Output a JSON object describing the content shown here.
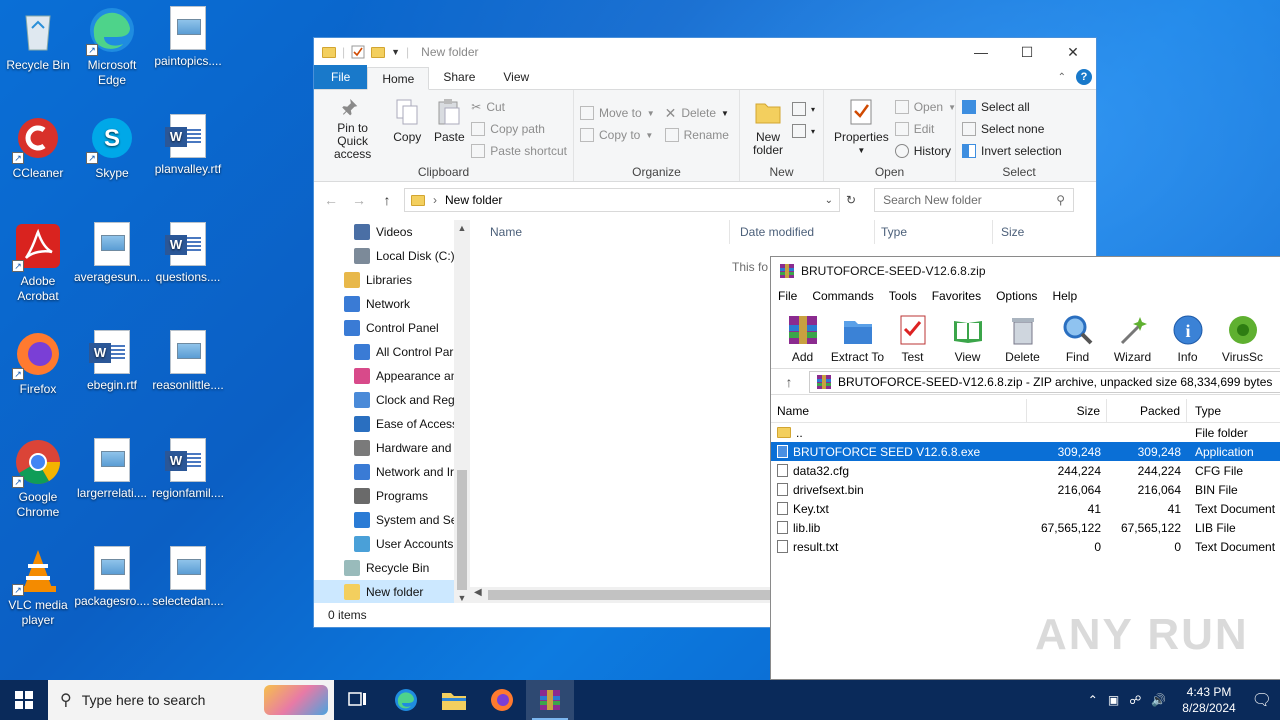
{
  "desktop": {
    "icons": [
      {
        "label": "Recycle Bin",
        "icon": "recycle-bin-icon"
      },
      {
        "label": "Microsoft Edge",
        "icon": "edge-icon"
      },
      {
        "label": "paintopics....",
        "icon": "image-file-icon"
      },
      {
        "label": "CCleaner",
        "icon": "ccleaner-icon"
      },
      {
        "label": "Skype",
        "icon": "skype-icon"
      },
      {
        "label": "planvalley.rtf",
        "icon": "word-doc-icon"
      },
      {
        "label": "Adobe Acrobat",
        "icon": "acrobat-icon"
      },
      {
        "label": "averagesun....",
        "icon": "image-file-icon"
      },
      {
        "label": "questions....",
        "icon": "word-doc-icon"
      },
      {
        "label": "Firefox",
        "icon": "firefox-icon"
      },
      {
        "label": "ebegin.rtf",
        "icon": "word-doc-icon"
      },
      {
        "label": "reasonlittle....",
        "icon": "image-file-icon"
      },
      {
        "label": "Google Chrome",
        "icon": "chrome-icon"
      },
      {
        "label": "largerrelati....",
        "icon": "image-file-icon"
      },
      {
        "label": "regionfamil....",
        "icon": "word-doc-icon"
      },
      {
        "label": "VLC media player",
        "icon": "vlc-icon"
      },
      {
        "label": "packagesro....",
        "icon": "image-file-icon"
      },
      {
        "label": "selectedan....",
        "icon": "image-file-icon"
      }
    ]
  },
  "explorer": {
    "title": "New folder",
    "tabs": {
      "file": "File",
      "home": "Home",
      "share": "Share",
      "view": "View"
    },
    "clipboard": {
      "pin": "Pin to Quick access",
      "copy": "Copy",
      "paste": "Paste",
      "cut": "Cut",
      "copy_path": "Copy path",
      "paste_shortcut": "Paste shortcut",
      "label": "Clipboard"
    },
    "organize": {
      "move_to": "Move to",
      "copy_to": "Copy to",
      "delete": "Delete",
      "rename": "Rename",
      "label": "Organize"
    },
    "new": {
      "new_folder": "New folder",
      "label": "New"
    },
    "open": {
      "properties": "Properties",
      "open": "Open",
      "edit": "Edit",
      "history": "History",
      "label": "Open"
    },
    "select": {
      "select_all": "Select all",
      "select_none": "Select none",
      "invert": "Invert selection",
      "label": "Select"
    },
    "address": "New folder",
    "search_placeholder": "Search New folder",
    "nav": [
      {
        "label": "Videos",
        "indent": 2,
        "icon": "videos-icon"
      },
      {
        "label": "Local Disk (C:)",
        "indent": 2,
        "icon": "disk-icon"
      },
      {
        "label": "Libraries",
        "indent": 1,
        "icon": "libraries-icon"
      },
      {
        "label": "Network",
        "indent": 1,
        "icon": "network-icon"
      },
      {
        "label": "Control Panel",
        "indent": 1,
        "icon": "control-panel-icon"
      },
      {
        "label": "All Control Par",
        "indent": 2,
        "icon": "control-panel-icon"
      },
      {
        "label": "Appearance an",
        "indent": 2,
        "icon": "appearance-icon"
      },
      {
        "label": "Clock and Regi",
        "indent": 2,
        "icon": "clock-icon"
      },
      {
        "label": "Ease of Access",
        "indent": 2,
        "icon": "ease-access-icon"
      },
      {
        "label": "Hardware and",
        "indent": 2,
        "icon": "hardware-icon"
      },
      {
        "label": "Network and Ir",
        "indent": 2,
        "icon": "network-icon"
      },
      {
        "label": "Programs",
        "indent": 2,
        "icon": "programs-icon"
      },
      {
        "label": "System and Sec",
        "indent": 2,
        "icon": "shield-icon"
      },
      {
        "label": "User Accounts",
        "indent": 2,
        "icon": "user-icon"
      },
      {
        "label": "Recycle Bin",
        "indent": 1,
        "icon": "recycle-bin-icon"
      },
      {
        "label": "New folder",
        "indent": 1,
        "icon": "folder-icon",
        "selected": true
      }
    ],
    "columns": {
      "name": "Name",
      "date": "Date modified",
      "type": "Type",
      "size": "Size"
    },
    "empty_message": "This fo",
    "status": "0 items"
  },
  "winrar": {
    "title": "BRUTOFORCE-SEED-V12.6.8.zip",
    "menu": [
      "File",
      "Commands",
      "Tools",
      "Favorites",
      "Options",
      "Help"
    ],
    "tools": [
      {
        "label": "Add",
        "icon": "add-archive-icon"
      },
      {
        "label": "Extract To",
        "icon": "extract-icon"
      },
      {
        "label": "Test",
        "icon": "test-icon"
      },
      {
        "label": "View",
        "icon": "view-icon"
      },
      {
        "label": "Delete",
        "icon": "trash-icon"
      },
      {
        "label": "Find",
        "icon": "find-icon"
      },
      {
        "label": "Wizard",
        "icon": "wizard-icon"
      },
      {
        "label": "Info",
        "icon": "info-icon"
      },
      {
        "label": "VirusSc",
        "icon": "virus-scan-icon"
      }
    ],
    "path": "BRUTOFORCE-SEED-V12.6.8.zip - ZIP archive, unpacked size 68,334,699 bytes",
    "columns": {
      "name": "Name",
      "size": "Size",
      "packed": "Packed",
      "type": "Type"
    },
    "rows": [
      {
        "name": "..",
        "size": "",
        "packed": "",
        "type": "File folder",
        "icon": "folder-icon"
      },
      {
        "name": "BRUTOFORCE SEED V12.6.8.exe",
        "size": "309,248",
        "packed": "309,248",
        "type": "Application",
        "icon": "exe-icon",
        "selected": true
      },
      {
        "name": "data32.cfg",
        "size": "244,224",
        "packed": "244,224",
        "type": "CFG File",
        "icon": "file-icon"
      },
      {
        "name": "drivefsext.bin",
        "size": "216,064",
        "packed": "216,064",
        "type": "BIN File",
        "icon": "file-icon"
      },
      {
        "name": "Key.txt",
        "size": "41",
        "packed": "41",
        "type": "Text Document",
        "icon": "text-file-icon"
      },
      {
        "name": "lib.lib",
        "size": "67,565,122",
        "packed": "67,565,122",
        "type": "LIB File",
        "icon": "file-icon"
      },
      {
        "name": "result.txt",
        "size": "0",
        "packed": "0",
        "type": "Text Document",
        "icon": "text-file-icon"
      }
    ]
  },
  "watermark": "ANY RUN",
  "taskbar": {
    "search_placeholder": "Type here to search",
    "time": "4:43 PM",
    "date": "8/28/2024"
  }
}
